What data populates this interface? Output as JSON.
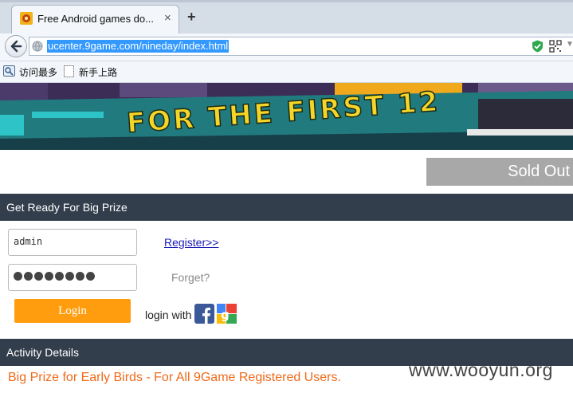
{
  "browser": {
    "tab_title": "Free Android games do...",
    "tab_close": "×",
    "new_tab": "+",
    "url": "ucenter.9game.com/nineday/index.html",
    "url_dropdown": "▼",
    "bookmarks": [
      {
        "label": "访问最多",
        "icon": "bookmarks-icon"
      },
      {
        "label": "新手上路",
        "icon": "page-icon"
      }
    ]
  },
  "banner": {
    "text": "FOR THE FIRST 12"
  },
  "sold_out_label": "Sold Out",
  "login_section": {
    "title": "Get Ready For Big Prize",
    "username_value": "admin",
    "password_mask_count": 8,
    "register_label": "Register>>",
    "forget_label": "Forget?",
    "login_label": "Login",
    "login_with_label": "login with"
  },
  "activity": {
    "title": "Activity Details",
    "promo_text": "Big Prize for Early Birds -  For All 9Game Registered Users."
  },
  "watermark": "www.wooyun.org",
  "colors": {
    "section_bar": "#333e4c",
    "login_button": "#ff9d0e",
    "promo_text": "#f06a1a",
    "sold_out": "#a8a8a8",
    "link": "#1a1ab5"
  }
}
